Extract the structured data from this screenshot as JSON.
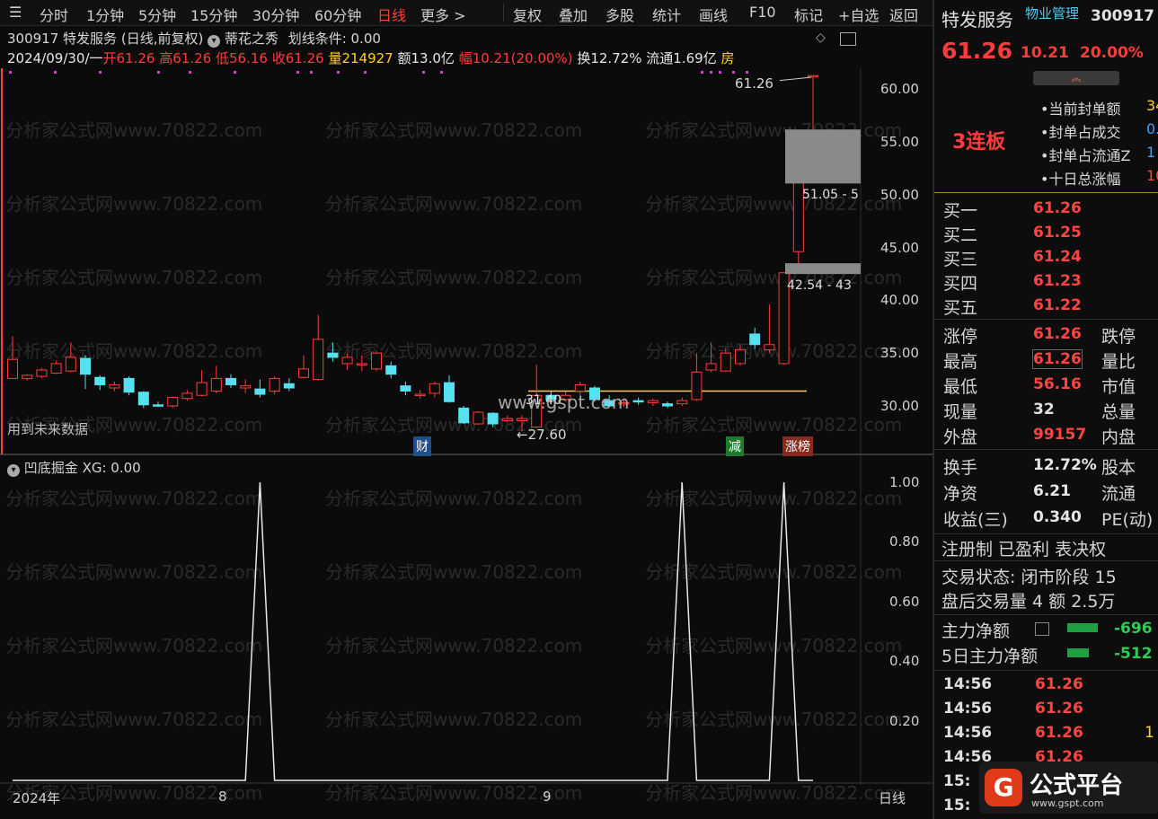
{
  "toolbar": {
    "items": [
      "分时",
      "1分钟",
      "5分钟",
      "15分钟",
      "30分钟",
      "60分钟",
      "日线",
      "更多 >",
      "复权",
      "叠加",
      "多股",
      "统计",
      "画线",
      "F10",
      "标记",
      "+自选",
      "返回"
    ]
  },
  "chart": {
    "title_code": "300917",
    "title_name": "特发服务",
    "title_mode": "(日线,前复权)",
    "indicator_name": "蒂花之秀",
    "indicator_cond": "划线条件: 0.00",
    "date": "2024/09/30/一",
    "open": "开61.26",
    "high": "高61.26",
    "low": "低56.16",
    "close": "收61.26",
    "volume": "量214927",
    "amount": "额13.0亿",
    "change": "幅10.21(20.00%)",
    "turnover": "换12.72%",
    "float": "流通1.69亿",
    "house": "房",
    "price_axis": [
      "60.00",
      "55.00",
      "50.00",
      "45.00",
      "40.00",
      "35.00",
      "30.00"
    ],
    "annot_high": "61.26",
    "annot_low": "27.60",
    "annot_box1": "51.05 - 5",
    "annot_box2": "42.54 - 43",
    "annot_mid": "31.40",
    "future_note": "用到未来数据",
    "tag_cai": "财",
    "tag_jian": "减",
    "tag_zhangbang": "涨榜",
    "watermark": "分析家公式网www.70822.com",
    "gspt_mark": "www.gspt.com"
  },
  "indicator": {
    "name": "凹底掘金",
    "value": "XG: 0.00",
    "axis": [
      "1.00",
      "0.80",
      "0.60",
      "0.40",
      "0.20"
    ]
  },
  "time_axis": {
    "year": "2024年",
    "m8": "8",
    "m9": "9",
    "period": "日线"
  },
  "quote": {
    "name": "特发服务",
    "industry": "物业管理",
    "code": "300917",
    "price": "61.26",
    "change": "10.21",
    "pct": "20.00%",
    "streak": "3连板",
    "seal_rows": [
      {
        "label": "当前封单额",
        "value": "34"
      },
      {
        "label": "封单占成交",
        "value": "0."
      },
      {
        "label": "封单占流通Z",
        "value": "1"
      },
      {
        "label": "十日总涨幅",
        "value": "10"
      }
    ],
    "bids": [
      {
        "label": "买一",
        "value": "61.26"
      },
      {
        "label": "买二",
        "value": "61.25"
      },
      {
        "label": "买三",
        "value": "61.24"
      },
      {
        "label": "买四",
        "value": "61.23"
      },
      {
        "label": "买五",
        "value": "61.22"
      }
    ],
    "stats": [
      {
        "l": "涨停",
        "v": "61.26",
        "r": "跌停"
      },
      {
        "l": "最高",
        "v": "61.26",
        "r": "量比"
      },
      {
        "l": "最低",
        "v": "56.16",
        "r": "市值"
      },
      {
        "l": "现量",
        "v": "32",
        "r": "总量"
      },
      {
        "l": "外盘",
        "v": "99157",
        "r": "内盘"
      }
    ],
    "stats2": [
      {
        "l": "换手",
        "v": "12.72%",
        "r": "股本"
      },
      {
        "l": "净资",
        "v": "6.21",
        "r": "流通"
      },
      {
        "l": "收益(三)",
        "v": "0.340",
        "r": "PE(动)"
      }
    ],
    "flags": "注册制 已盈利 表决权",
    "trade_state": "交易状态: 闭市阶段 15",
    "after_hours": "盘后交易量 4 额 2.5万",
    "main_net": {
      "label": "主力净额",
      "value": "-696"
    },
    "main_net5": {
      "label": "5日主力净额",
      "value": "-512"
    },
    "ticks": [
      {
        "t": "14:56",
        "p": "61.26",
        "v": ""
      },
      {
        "t": "14:56",
        "p": "61.26",
        "v": ""
      },
      {
        "t": "14:56",
        "p": "61.26",
        "v": "1"
      },
      {
        "t": "14:56",
        "p": "61.26",
        "v": ""
      },
      {
        "t": "15:",
        "p": "",
        "v": ""
      },
      {
        "t": "15:",
        "p": "",
        "v": ""
      }
    ],
    "brand": "公式平台",
    "brand_url": "www.gspt.com"
  },
  "colors": {
    "up": "#ff3b3b",
    "down": "#56e1f0",
    "bg": "#0b0b0b",
    "grid": "#2a2a2a",
    "yellow": "#ffd21a"
  },
  "chart_data": {
    "type": "candlestick",
    "price_unit": "CNY",
    "ylim": [
      27,
      62
    ],
    "candles": [
      {
        "o": 32.6,
        "c": 34.4,
        "h": 36.6,
        "l": 32.6
      },
      {
        "o": 32.6,
        "c": 32.9,
        "h": 33.0,
        "l": 32.4
      },
      {
        "o": 32.8,
        "c": 33.4,
        "h": 33.6,
        "l": 32.6
      },
      {
        "o": 33.1,
        "c": 34.0,
        "h": 34.3,
        "l": 33.0
      },
      {
        "o": 33.3,
        "c": 34.6,
        "h": 36.0,
        "l": 33.2
      },
      {
        "o": 34.5,
        "c": 33.0,
        "h": 34.8,
        "l": 31.6
      },
      {
        "o": 32.7,
        "c": 32.0,
        "h": 32.9,
        "l": 31.5
      },
      {
        "o": 31.7,
        "c": 32.0,
        "h": 32.3,
        "l": 31.4
      },
      {
        "o": 32.6,
        "c": 31.3,
        "h": 32.8,
        "l": 31.0
      },
      {
        "o": 31.3,
        "c": 30.1,
        "h": 31.4,
        "l": 29.8
      },
      {
        "o": 30.1,
        "c": 30.0,
        "h": 30.4,
        "l": 29.9
      },
      {
        "o": 30.0,
        "c": 30.8,
        "h": 30.9,
        "l": 29.8
      },
      {
        "o": 30.7,
        "c": 31.2,
        "h": 31.5,
        "l": 30.5
      },
      {
        "o": 31.0,
        "c": 32.2,
        "h": 33.4,
        "l": 30.9
      },
      {
        "o": 31.4,
        "c": 32.6,
        "h": 33.8,
        "l": 31.2
      },
      {
        "o": 32.6,
        "c": 32.0,
        "h": 33.0,
        "l": 31.7
      },
      {
        "o": 31.7,
        "c": 31.9,
        "h": 32.5,
        "l": 31.2
      },
      {
        "o": 31.6,
        "c": 31.1,
        "h": 32.5,
        "l": 30.8
      },
      {
        "o": 31.4,
        "c": 32.6,
        "h": 32.8,
        "l": 31.1
      },
      {
        "o": 32.1,
        "c": 31.7,
        "h": 32.6,
        "l": 31.4
      },
      {
        "o": 32.7,
        "c": 33.5,
        "h": 34.8,
        "l": 32.6
      },
      {
        "o": 32.5,
        "c": 36.3,
        "h": 38.6,
        "l": 32.4
      },
      {
        "o": 35.0,
        "c": 34.6,
        "h": 36.0,
        "l": 34.2
      },
      {
        "o": 34.0,
        "c": 34.6,
        "h": 35.0,
        "l": 33.4
      },
      {
        "o": 34.0,
        "c": 34.0,
        "h": 34.8,
        "l": 33.3
      },
      {
        "o": 33.5,
        "c": 35.0,
        "h": 35.2,
        "l": 33.3
      },
      {
        "o": 33.8,
        "c": 33.0,
        "h": 34.2,
        "l": 32.6
      },
      {
        "o": 31.9,
        "c": 31.4,
        "h": 32.3,
        "l": 31.0
      },
      {
        "o": 31.1,
        "c": 31.1,
        "h": 31.5,
        "l": 30.7
      },
      {
        "o": 31.2,
        "c": 32.1,
        "h": 32.3,
        "l": 30.8
      },
      {
        "o": 32.2,
        "c": 30.4,
        "h": 32.9,
        "l": 30.3
      },
      {
        "o": 29.8,
        "c": 28.4,
        "h": 30.0,
        "l": 28.3
      },
      {
        "o": 28.3,
        "c": 29.4,
        "h": 29.5,
        "l": 28.2
      },
      {
        "o": 29.3,
        "c": 28.3,
        "h": 29.4,
        "l": 28.0
      },
      {
        "o": 28.6,
        "c": 28.8,
        "h": 29.1,
        "l": 28.5
      },
      {
        "o": 28.6,
        "c": 28.8,
        "h": 29.1,
        "l": 27.6
      },
      {
        "o": 28.0,
        "c": 31.0,
        "h": 33.9,
        "l": 27.9
      },
      {
        "o": 31.0,
        "c": 30.6,
        "h": 31.4,
        "l": 30.4
      },
      {
        "o": 30.6,
        "c": 31.0,
        "h": 31.4,
        "l": 30.4
      },
      {
        "o": 31.4,
        "c": 32.0,
        "h": 32.3,
        "l": 31.0
      },
      {
        "o": 31.7,
        "c": 30.6,
        "h": 31.9,
        "l": 30.4
      },
      {
        "o": 30.5,
        "c": 30.0,
        "h": 31.0,
        "l": 29.9
      },
      {
        "o": 30.2,
        "c": 30.3,
        "h": 30.6,
        "l": 29.9
      },
      {
        "o": 30.5,
        "c": 30.4,
        "h": 30.8,
        "l": 30.1
      },
      {
        "o": 30.3,
        "c": 30.5,
        "h": 30.7,
        "l": 30.0
      },
      {
        "o": 30.2,
        "c": 30.0,
        "h": 30.4,
        "l": 29.8
      },
      {
        "o": 30.2,
        "c": 30.5,
        "h": 30.8,
        "l": 30.0
      },
      {
        "o": 30.6,
        "c": 33.2,
        "h": 35.0,
        "l": 30.5
      },
      {
        "o": 33.4,
        "c": 34.0,
        "h": 36.0,
        "l": 33.2
      },
      {
        "o": 33.3,
        "c": 35.0,
        "h": 35.5,
        "l": 33.2
      },
      {
        "o": 34.0,
        "c": 35.3,
        "h": 35.8,
        "l": 33.8
      },
      {
        "o": 36.8,
        "c": 35.8,
        "h": 37.4,
        "l": 35.4
      },
      {
        "o": 35.3,
        "c": 35.8,
        "h": 39.6,
        "l": 35.0
      },
      {
        "o": 34.0,
        "c": 42.6,
        "h": 42.6,
        "l": 33.9
      },
      {
        "o": 44.6,
        "c": 51.1,
        "h": 51.1,
        "l": 43.5
      },
      {
        "o": 61.26,
        "c": 61.26,
        "h": 61.26,
        "l": 56.16
      }
    ],
    "yellow_line": {
      "value": 31.4
    },
    "gap_boxes": [
      {
        "from": 51.05,
        "to": 56.16
      },
      {
        "from": 42.54,
        "to": 43.5
      }
    ],
    "indicator_series": {
      "name": "XG",
      "spikes_at": [
        17,
        46,
        53
      ],
      "ylim": [
        0,
        1.0
      ]
    }
  }
}
